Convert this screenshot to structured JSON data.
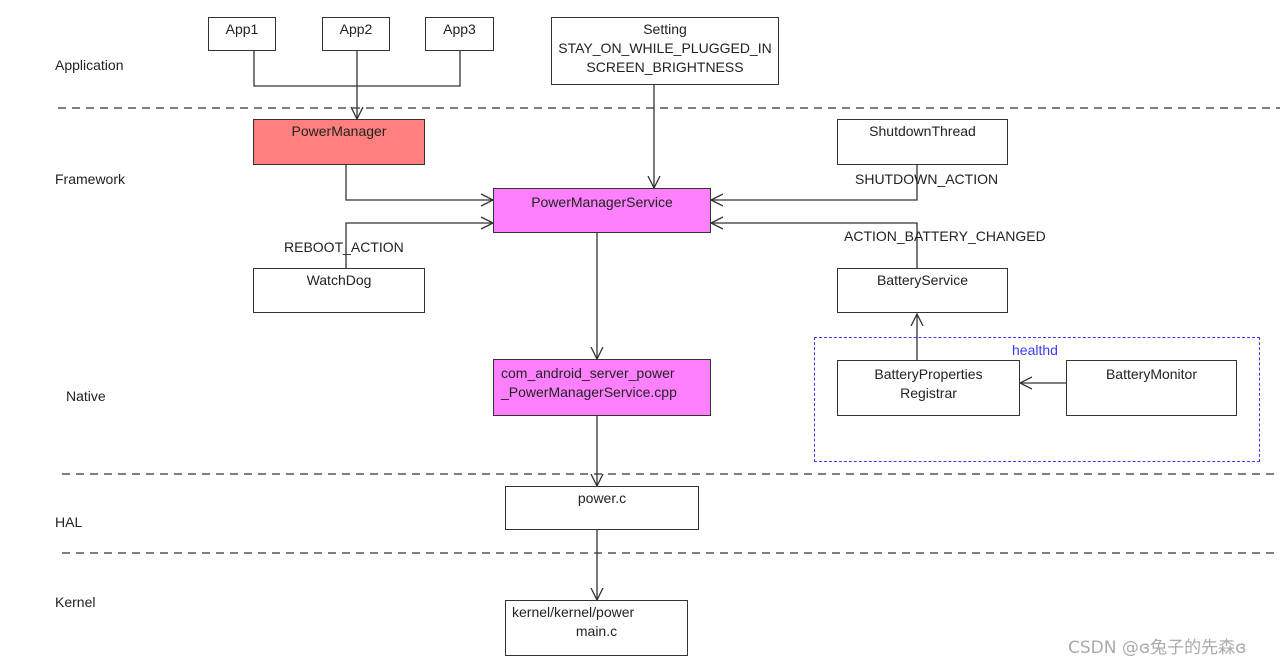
{
  "layers": {
    "application": "Application",
    "framework": "Framework",
    "native": "Native",
    "hal": "HAL",
    "kernel": "Kernel"
  },
  "nodes": {
    "app1": "App1",
    "app2": "App2",
    "app3": "App3",
    "setting": [
      "Setting",
      "STAY_ON_WHILE_PLUGGED_IN",
      "SCREEN_BRIGHTNESS"
    ],
    "power_manager": "PowerManager",
    "shutdown_thread": "ShutdownThread",
    "power_manager_service": "PowerManagerService",
    "watchdog": "WatchDog",
    "battery_service": "BatteryService",
    "jni": [
      "com_android_server_power",
      "_PowerManagerService.cpp"
    ],
    "battery_properties_registrar": [
      "BatteryProperties",
      "Registrar"
    ],
    "battery_monitor": "BatteryMonitor",
    "power_c": "power.c",
    "kernel_main": [
      "kernel/kernel/power",
      "main.c"
    ]
  },
  "edge_labels": {
    "shutdown_action": "SHUTDOWN_ACTION",
    "reboot_action": "REBOOT_ACTION",
    "battery_changed": "ACTION_BATTERY_CHANGED"
  },
  "groups": {
    "healthd": "healthd"
  },
  "colors": {
    "power_manager_fill": "#ff7f7f",
    "service_fill": "#ff80ff",
    "healthd_border": "#3b3bff"
  },
  "watermark": "CSDN @ɞ兔子的先森ɞ"
}
